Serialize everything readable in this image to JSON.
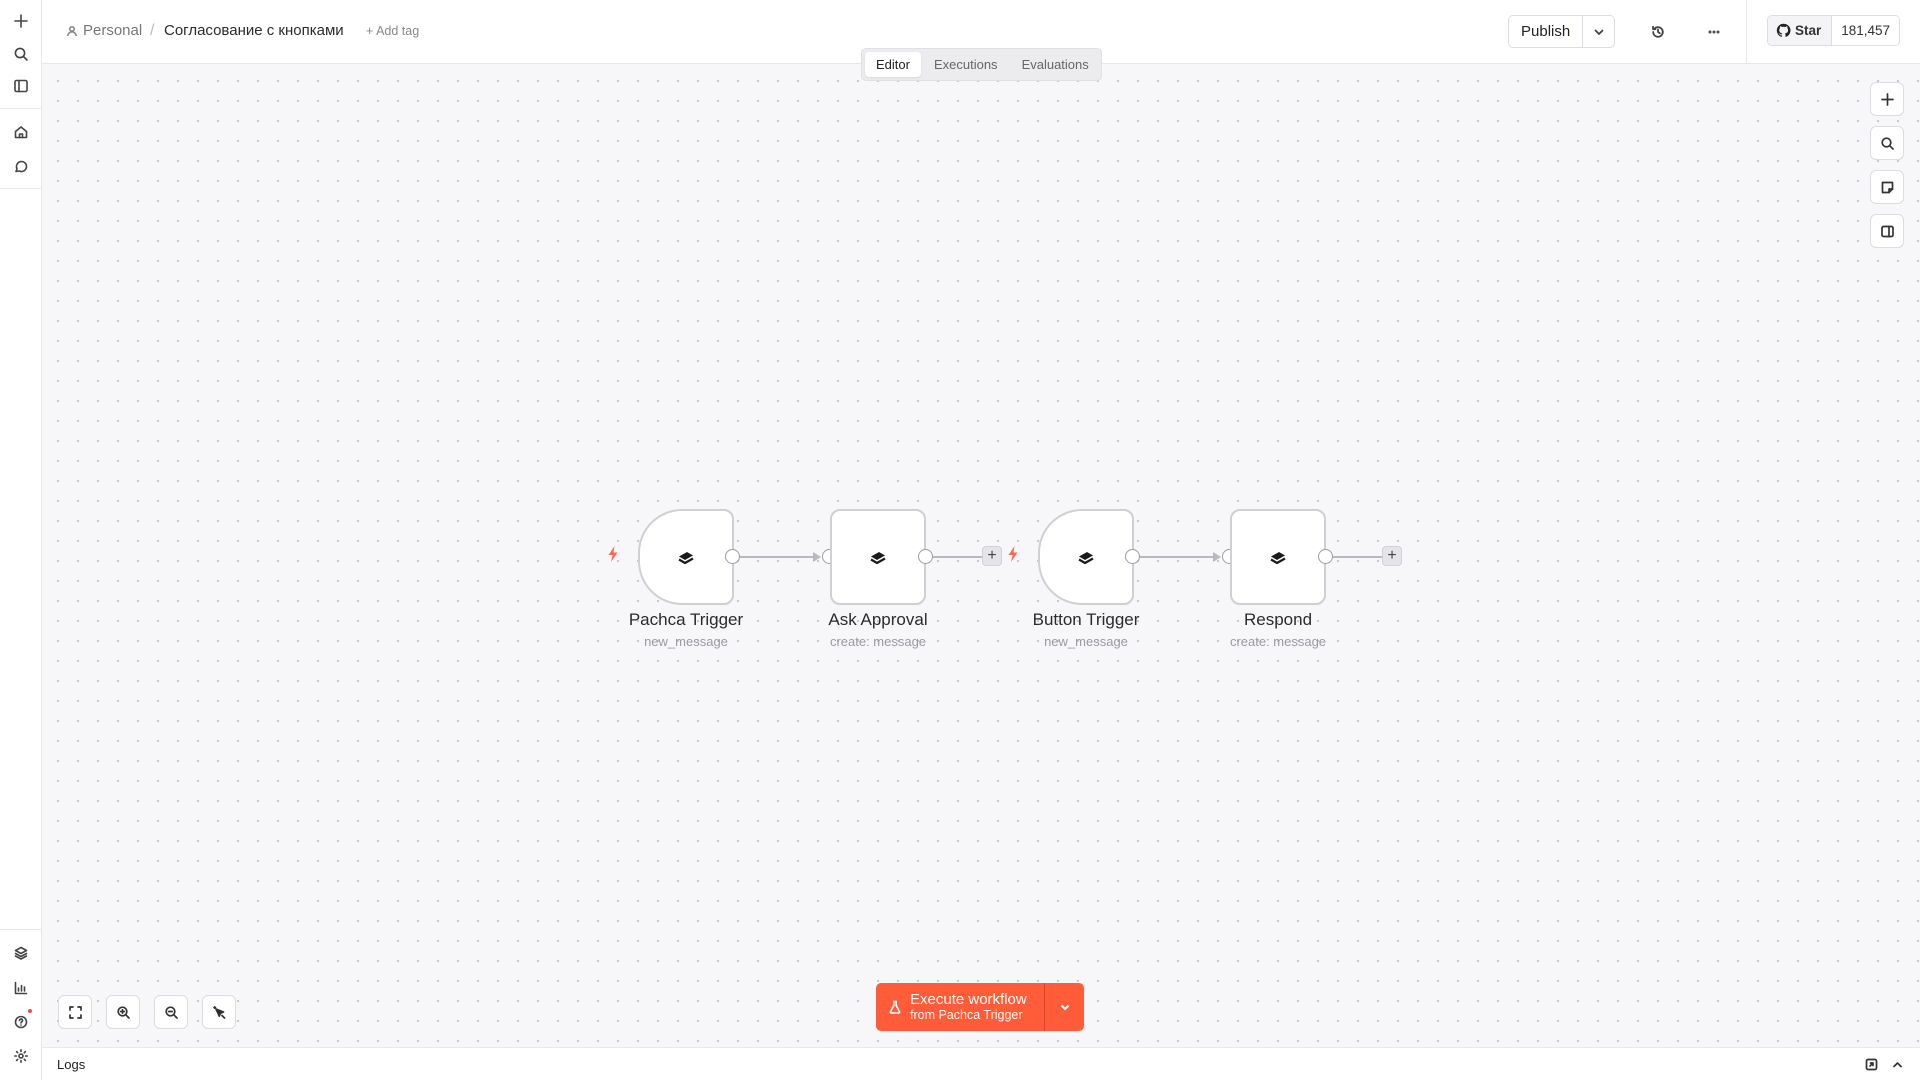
{
  "breadcrumb": {
    "project": "Personal",
    "separator": "/",
    "workflow_name": "Согласование с кнопками",
    "add_tag": "+ Add tag"
  },
  "header": {
    "publish_label": "Publish",
    "github_star_label": "Star",
    "github_star_count": "181,457"
  },
  "tabs": [
    {
      "label": "Editor",
      "active": true
    },
    {
      "label": "Executions",
      "active": false
    },
    {
      "label": "Evaluations",
      "active": false
    }
  ],
  "nodes": [
    {
      "title": "Pachca Trigger",
      "subtitle": "new_message",
      "kind": "trigger"
    },
    {
      "title": "Ask Approval",
      "subtitle": "create: message",
      "kind": "action"
    },
    {
      "title": "Button Trigger",
      "subtitle": "new_message",
      "kind": "trigger"
    },
    {
      "title": "Respond",
      "subtitle": "create: message",
      "kind": "action"
    }
  ],
  "execute": {
    "label": "Execute workflow",
    "sublabel": "from Pachca Trigger"
  },
  "logs": {
    "label": "Logs"
  },
  "colors": {
    "accent": "#ff5c3a",
    "trigger_bolt": "#ff6a55",
    "canvas_bg": "#f7f6f9",
    "node_border": "#cfcfd4"
  }
}
